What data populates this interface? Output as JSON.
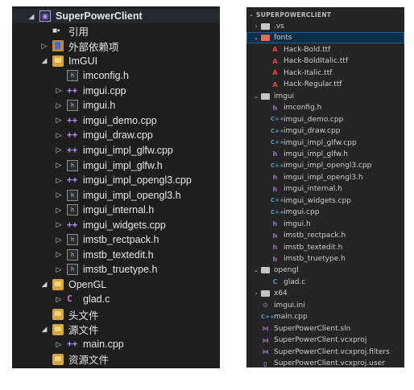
{
  "solution_explorer": {
    "rows": [
      {
        "label": "SuperPowerClient",
        "icon": "solution-icon",
        "arrow": "expanded",
        "indent": 0,
        "bold": true,
        "selected": true
      },
      {
        "label": "引用",
        "icon": "references-icon",
        "arrow": "none",
        "indent": 1
      },
      {
        "label": "外部依赖项",
        "icon": "external-dependencies-icon",
        "arrow": "collapsed",
        "indent": 1
      },
      {
        "label": "ImGUI",
        "icon": "filter-folder-icon",
        "arrow": "expanded",
        "indent": 1
      },
      {
        "label": "imconfig.h",
        "icon": "header-file-icon",
        "arrow": "none",
        "indent": 2
      },
      {
        "label": "imgui.cpp",
        "icon": "cpp-file-icon",
        "arrow": "collapsed",
        "indent": 2
      },
      {
        "label": "imgui.h",
        "icon": "header-file-icon",
        "arrow": "collapsed",
        "indent": 2
      },
      {
        "label": "imgui_demo.cpp",
        "icon": "cpp-file-icon",
        "arrow": "collapsed",
        "indent": 2
      },
      {
        "label": "imgui_draw.cpp",
        "icon": "cpp-file-icon",
        "arrow": "collapsed",
        "indent": 2
      },
      {
        "label": "imgui_impl_glfw.cpp",
        "icon": "cpp-file-icon",
        "arrow": "collapsed",
        "indent": 2
      },
      {
        "label": "imgui_impl_glfw.h",
        "icon": "header-file-icon",
        "arrow": "collapsed",
        "indent": 2
      },
      {
        "label": "imgui_impl_opengl3.cpp",
        "icon": "cpp-file-icon",
        "arrow": "collapsed",
        "indent": 2
      },
      {
        "label": "imgui_impl_opengl3.h",
        "icon": "header-file-icon",
        "arrow": "collapsed",
        "indent": 2
      },
      {
        "label": "imgui_internal.h",
        "icon": "header-file-icon",
        "arrow": "collapsed",
        "indent": 2
      },
      {
        "label": "imgui_widgets.cpp",
        "icon": "cpp-file-icon",
        "arrow": "collapsed",
        "indent": 2
      },
      {
        "label": "imstb_rectpack.h",
        "icon": "header-file-icon",
        "arrow": "collapsed",
        "indent": 2
      },
      {
        "label": "imstb_textedit.h",
        "icon": "header-file-icon",
        "arrow": "collapsed",
        "indent": 2
      },
      {
        "label": "imstb_truetype.h",
        "icon": "header-file-icon",
        "arrow": "collapsed",
        "indent": 2
      },
      {
        "label": "OpenGL",
        "icon": "filter-folder-icon",
        "arrow": "expanded",
        "indent": 1
      },
      {
        "label": "glad.c",
        "icon": "c-file-icon",
        "arrow": "collapsed",
        "indent": 2
      },
      {
        "label": "头文件",
        "icon": "filter-folder-icon",
        "arrow": "none",
        "indent": 1
      },
      {
        "label": "源文件",
        "icon": "filter-folder-icon",
        "arrow": "expanded",
        "indent": 1
      },
      {
        "label": "main.cpp",
        "icon": "cpp-file-icon",
        "arrow": "collapsed",
        "indent": 2
      },
      {
        "label": "资源文件",
        "icon": "filter-folder-icon",
        "arrow": "none",
        "indent": 1
      }
    ]
  },
  "code_explorer": {
    "header": "SUPERPOWERCLIENT",
    "rows": [
      {
        "label": ".vs",
        "icon": "folder-icon",
        "arrow": "collapsed",
        "indent": 0
      },
      {
        "label": "fonts",
        "icon": "font-folder-icon",
        "arrow": "expanded",
        "indent": 0,
        "selected": true
      },
      {
        "label": "Hack-Bold.ttf",
        "icon": "font-file-icon",
        "arrow": "none",
        "indent": 1
      },
      {
        "label": "Hack-BoldItalic.ttf",
        "icon": "font-file-icon",
        "arrow": "none",
        "indent": 1
      },
      {
        "label": "Hack-Italic.ttf",
        "icon": "font-file-icon",
        "arrow": "none",
        "indent": 1
      },
      {
        "label": "Hack-Regular.ttf",
        "icon": "font-file-icon",
        "arrow": "none",
        "indent": 1
      },
      {
        "label": "imgui",
        "icon": "folder-icon",
        "arrow": "expanded",
        "indent": 0
      },
      {
        "label": "imconfig.h",
        "icon": "h-file-icon",
        "arrow": "none",
        "indent": 1
      },
      {
        "label": "imgui_demo.cpp",
        "icon": "cpp-file-icon",
        "arrow": "none",
        "indent": 1
      },
      {
        "label": "imgui_draw.cpp",
        "icon": "cpp-file-icon",
        "arrow": "none",
        "indent": 1
      },
      {
        "label": "imgui_impl_glfw.cpp",
        "icon": "cpp-file-icon",
        "arrow": "none",
        "indent": 1
      },
      {
        "label": "imgui_impl_glfw.h",
        "icon": "h-file-icon",
        "arrow": "none",
        "indent": 1
      },
      {
        "label": "imgui_impl_opengl3.cpp",
        "icon": "cpp-file-icon",
        "arrow": "none",
        "indent": 1
      },
      {
        "label": "imgui_impl_opengl3.h",
        "icon": "h-file-icon",
        "arrow": "none",
        "indent": 1
      },
      {
        "label": "imgui_internal.h",
        "icon": "h-file-icon",
        "arrow": "none",
        "indent": 1
      },
      {
        "label": "imgui_widgets.cpp",
        "icon": "cpp-file-icon",
        "arrow": "none",
        "indent": 1
      },
      {
        "label": "imgui.cpp",
        "icon": "cpp-file-icon",
        "arrow": "none",
        "indent": 1
      },
      {
        "label": "imgui.h",
        "icon": "h-file-icon",
        "arrow": "none",
        "indent": 1
      },
      {
        "label": "imstb_rectpack.h",
        "icon": "h-file-icon",
        "arrow": "none",
        "indent": 1
      },
      {
        "label": "imstb_textedit.h",
        "icon": "h-file-icon",
        "arrow": "none",
        "indent": 1
      },
      {
        "label": "imstb_truetype.h",
        "icon": "h-file-icon",
        "arrow": "none",
        "indent": 1
      },
      {
        "label": "opengl",
        "icon": "folder-icon",
        "arrow": "expanded",
        "indent": 0
      },
      {
        "label": "glad.c",
        "icon": "c-file-icon",
        "arrow": "none",
        "indent": 1
      },
      {
        "label": "x64",
        "icon": "folder-icon",
        "arrow": "collapsed",
        "indent": 0
      },
      {
        "label": "imgui.ini",
        "icon": "gear-icon",
        "arrow": "none",
        "indent": 0
      },
      {
        "label": "main.cpp",
        "icon": "cpp-file-icon",
        "arrow": "none",
        "indent": 0
      },
      {
        "label": "SuperPowerClient.sln",
        "icon": "vs-solution-icon",
        "arrow": "none",
        "indent": 0
      },
      {
        "label": "SuperPowerClient.vcxproj",
        "icon": "vs-solution-icon",
        "arrow": "none",
        "indent": 0
      },
      {
        "label": "SuperPowerClient.vcxproj.filters",
        "icon": "vs-solution-icon",
        "arrow": "none",
        "indent": 0
      },
      {
        "label": "SuperPowerClient.vcxproj.user",
        "icon": "file-icon",
        "arrow": "none",
        "indent": 0
      }
    ]
  },
  "colors": {
    "vs_background": "#1e1e1e",
    "code_background": "#252526",
    "selection": "#0e2f49"
  }
}
